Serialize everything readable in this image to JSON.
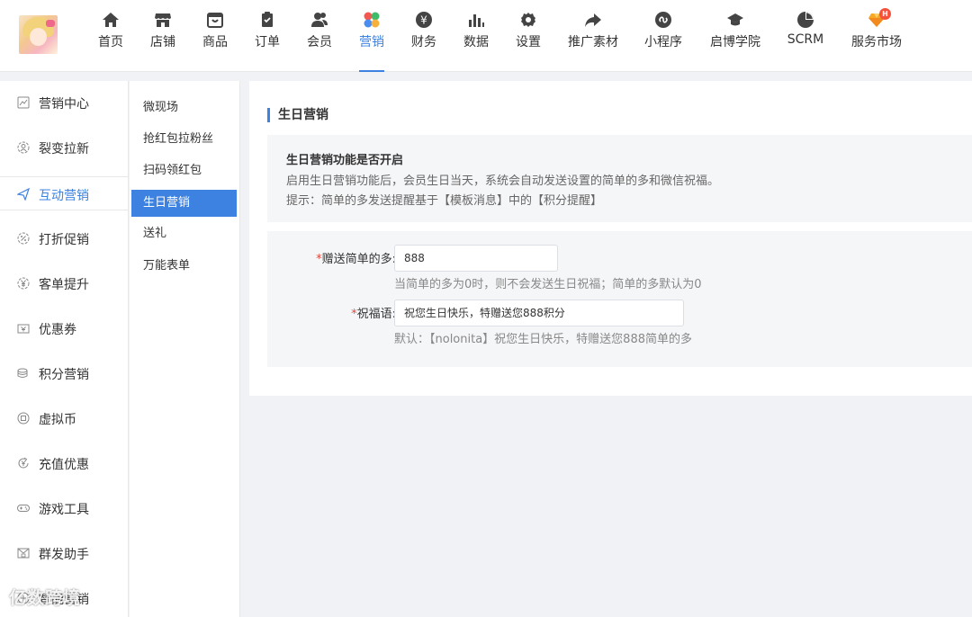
{
  "topnav": {
    "items": [
      {
        "label": "首页",
        "icon": "home-icon"
      },
      {
        "label": "店铺",
        "icon": "store-icon"
      },
      {
        "label": "商品",
        "icon": "goods-icon"
      },
      {
        "label": "订单",
        "icon": "order-icon"
      },
      {
        "label": "会员",
        "icon": "member-icon"
      },
      {
        "label": "营销",
        "icon": "marketing-icon",
        "active": true
      },
      {
        "label": "财务",
        "icon": "finance-icon"
      },
      {
        "label": "数据",
        "icon": "data-icon"
      },
      {
        "label": "设置",
        "icon": "settings-icon"
      },
      {
        "label": "推广素材",
        "icon": "share-icon"
      },
      {
        "label": "小程序",
        "icon": "miniprogram-icon"
      },
      {
        "label": "启博学院",
        "icon": "academy-icon"
      },
      {
        "label": "SCRM",
        "icon": "scrm-icon"
      },
      {
        "label": "服务市场",
        "icon": "market-icon",
        "badge": "H"
      }
    ]
  },
  "sidebar": {
    "items": [
      {
        "label": "营销中心",
        "icon": "chart-icon"
      },
      {
        "label": "裂变拉新",
        "icon": "fission-icon"
      },
      {
        "label": "互动营销",
        "icon": "send-icon",
        "active": true
      },
      {
        "label": "打折促销",
        "icon": "discount-icon"
      },
      {
        "label": "客单提升",
        "icon": "yen-icon"
      },
      {
        "label": "优惠券",
        "icon": "coupon-icon"
      },
      {
        "label": "积分营销",
        "icon": "points-icon"
      },
      {
        "label": "虚拟币",
        "icon": "coin-icon"
      },
      {
        "label": "充值优惠",
        "icon": "recharge-icon"
      },
      {
        "label": "游戏工具",
        "icon": "gamepad-icon"
      },
      {
        "label": "群发助手",
        "icon": "mail-icon"
      },
      {
        "label": "智能营销",
        "icon": "smart-icon"
      }
    ]
  },
  "subnav": {
    "items": [
      {
        "label": "微现场"
      },
      {
        "label": "抢红包拉粉丝"
      },
      {
        "label": "扫码领红包"
      },
      {
        "label": "生日营销",
        "active": true
      },
      {
        "label": "送礼"
      },
      {
        "label": "万能表单"
      }
    ]
  },
  "main": {
    "title": "生日营销",
    "info": {
      "heading": "生日营销功能是否开启",
      "line1": "启用生日营销功能后，会员生日当天，系统会自动发送设置的简单的多和微信祝福。",
      "line2": "提示：简单的多发送提醒基于【模板消息】中的【积分提醒】"
    },
    "form": {
      "gift": {
        "required_mark": "*",
        "label": "赠送简单的多:",
        "value": "888",
        "hint": "当简单的多为0时，则不会发送生日祝福；简单的多默认为0"
      },
      "greeting": {
        "required_mark": "*",
        "label": "祝福语:",
        "value": "祝您生日快乐，特赠送您888积分",
        "hint": "默认：【nolonita】祝您生日快乐，特赠送您888简单的多"
      }
    }
  },
  "watermark": "亿数跨境",
  "colors": {
    "accent": "#3d82e0",
    "required": "#e6483d",
    "badge": "#f5503c"
  }
}
